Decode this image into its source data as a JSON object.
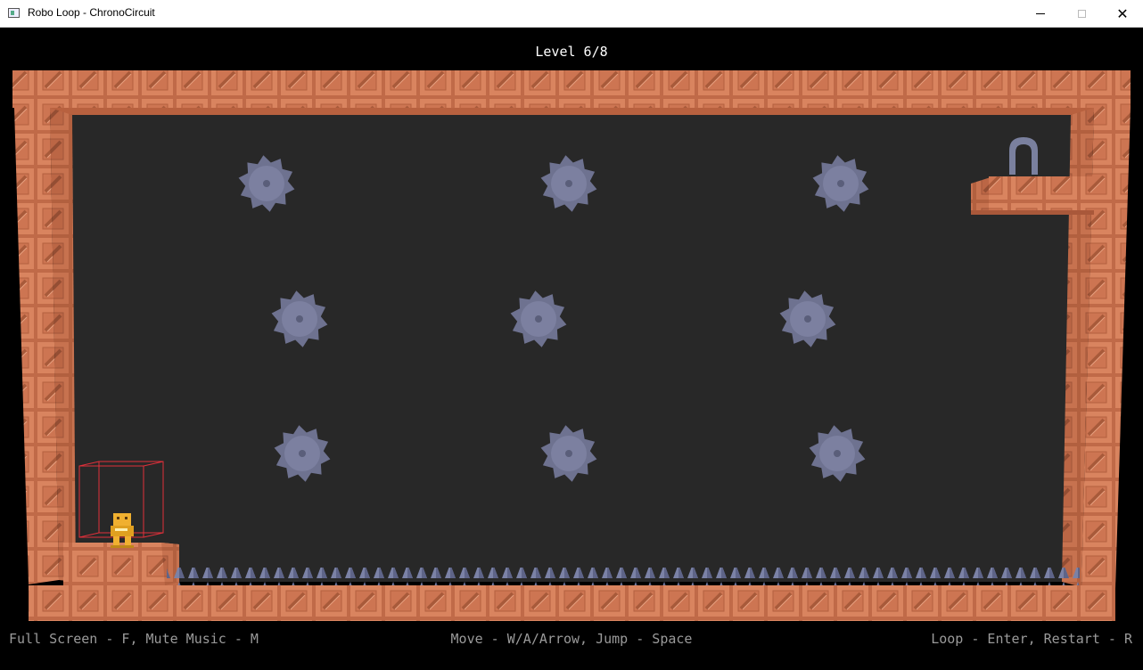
{
  "window": {
    "title": "Robo Loop - ChronoCircuit",
    "controls": [
      "minimize",
      "maximize",
      "close"
    ],
    "close_glyph": "✕"
  },
  "hud": {
    "level": "Level 6/8",
    "help_left": "Full Screen - F, Mute Music - M",
    "help_center": "Move - W/A/Arrow, Jump - Space",
    "help_right": "Loop - Enter, Restart - R"
  },
  "scene": {
    "background_color": "#282828",
    "brick_color": "#d9845f",
    "saw_color": "#6e7290",
    "spike_color": "#7b82a6",
    "player_color": "#f0b030",
    "selection_box_color": "#e0303a",
    "saw_blade_count": 9,
    "exit_door": "arch"
  }
}
